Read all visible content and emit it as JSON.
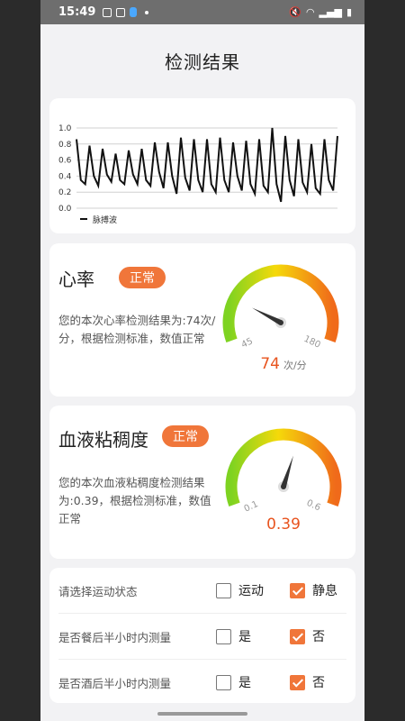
{
  "status_bar": {
    "time": "15:49"
  },
  "page": {
    "title": "检测结果"
  },
  "pulse_chart": {
    "legend": "脉搏波",
    "chart_data": {
      "type": "line",
      "yticks": [
        "1.0",
        "0.8",
        "0.6",
        "0.4",
        "0.2",
        "0.0"
      ],
      "ylim": [
        0,
        1.0
      ],
      "grid": true,
      "legend_position": "bottom-left",
      "series": [
        {
          "name": "脉搏波",
          "values": [
            0.86,
            0.35,
            0.3,
            0.78,
            0.4,
            0.28,
            0.74,
            0.42,
            0.33,
            0.68,
            0.35,
            0.3,
            0.72,
            0.42,
            0.3,
            0.74,
            0.35,
            0.28,
            0.82,
            0.45,
            0.25,
            0.82,
            0.4,
            0.18,
            0.88,
            0.38,
            0.22,
            0.86,
            0.35,
            0.2,
            0.86,
            0.3,
            0.2,
            0.88,
            0.35,
            0.2,
            0.82,
            0.4,
            0.22,
            0.84,
            0.3,
            0.18,
            0.86,
            0.28,
            0.2,
            1.0,
            0.3,
            0.08,
            0.9,
            0.35,
            0.15,
            0.86,
            0.32,
            0.2,
            0.8,
            0.25,
            0.18,
            0.86,
            0.35,
            0.22,
            0.9
          ]
        }
      ]
    }
  },
  "heart_rate": {
    "title": "心率",
    "badge": "正常",
    "description": "您的本次心率检测结果为:74次/分，根据检测标准，数值正常",
    "gauge": {
      "min_label": "45",
      "max_label": "180",
      "value": "74",
      "unit": "次/分",
      "value_num": 74,
      "min": 45,
      "max": 180
    }
  },
  "viscosity": {
    "title": "血液粘稠度",
    "badge": "正常",
    "description": "您的本次血液粘稠度检测结果为:0.39，根据检测标准，数值正常",
    "gauge": {
      "min_label": "0.1",
      "max_label": "0.6",
      "value": "0.39",
      "value_num": 0.39,
      "min": 0.1,
      "max": 0.6
    }
  },
  "options": [
    {
      "label": "请选择运动状态",
      "choices": [
        {
          "text": "运动",
          "checked": false
        },
        {
          "text": "静息",
          "checked": true
        }
      ]
    },
    {
      "label": "是否餐后半小时内测量",
      "choices": [
        {
          "text": "是",
          "checked": false
        },
        {
          "text": "否",
          "checked": true
        }
      ]
    },
    {
      "label": "是否酒后半小时内测量",
      "choices": [
        {
          "text": "是",
          "checked": false
        },
        {
          "text": "否",
          "checked": true
        }
      ]
    }
  ],
  "colors": {
    "accent": "#f0763a",
    "value": "#e8541f",
    "gauge_start": "#7ed321",
    "gauge_mid": "#f5d90a",
    "gauge_end": "#f06a1a"
  }
}
